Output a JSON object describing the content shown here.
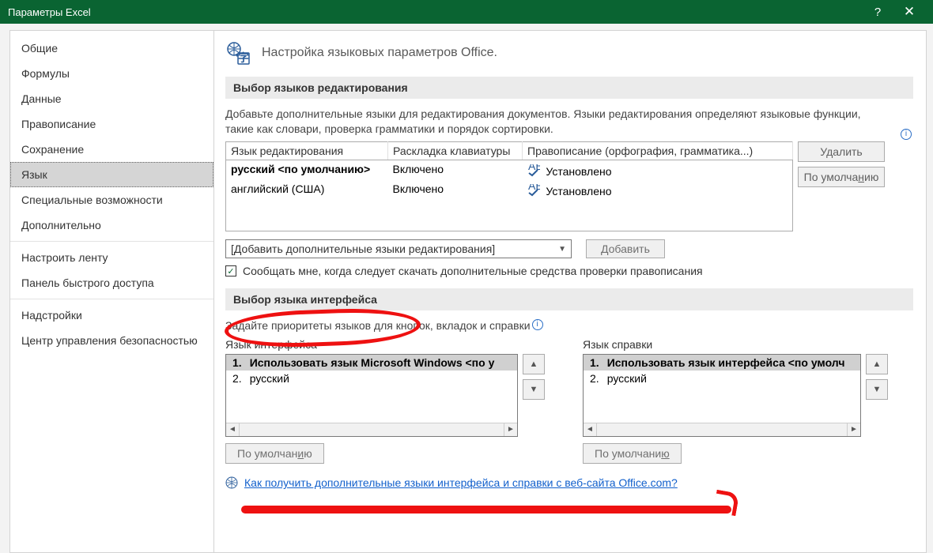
{
  "window": {
    "title": "Параметры Excel",
    "help": "?",
    "close": "✕"
  },
  "nav": {
    "items": [
      "Общие",
      "Формулы",
      "Данные",
      "Правописание",
      "Сохранение",
      "Язык",
      "Специальные возможности",
      "Дополнительно"
    ],
    "items2": [
      "Настроить ленту",
      "Панель быстрого доступа"
    ],
    "items3": [
      "Надстройки",
      "Центр управления безопасностью"
    ],
    "selected": "Язык"
  },
  "header": {
    "title": "Настройка языковых параметров Office."
  },
  "section1": {
    "title": "Выбор языков редактирования",
    "desc": "Добавьте дополнительные языки для редактирования документов. Языки редактирования определяют языковые функции, такие как словари, проверка грамматики и порядок сортировки.",
    "colLang": "Язык редактирования",
    "colLayout": "Раскладка клавиатуры",
    "colProof": "Правописание (орфография, грамматика...)",
    "rows": [
      {
        "lang": "русский <по умолчанию>",
        "layout": "Включено",
        "proof": "Установлено",
        "bold": true
      },
      {
        "lang": "английский (США)",
        "layout": "Включено",
        "proof": "Установлено",
        "bold": false
      }
    ],
    "btnRemove": "Удалить",
    "btnDefault": "По умолчанию",
    "addCombo": "[Добавить дополнительные языки редактирования]",
    "btnAdd": "Добавить",
    "notify": "Сообщать мне, когда следует скачать дополнительные средства проверки правописания"
  },
  "section2": {
    "title": "Выбор языка интерфейса",
    "desc": "Задайте приоритеты языков для кнопок, вкладок и справки",
    "left": {
      "label": "Язык интерфейса",
      "items": [
        {
          "n": "1.",
          "t": "Использовать язык Microsoft Windows <по у"
        },
        {
          "n": "2.",
          "t": "русский"
        }
      ],
      "btn": "По умолчанию"
    },
    "right": {
      "label": "Язык справки",
      "items": [
        {
          "n": "1.",
          "t": "Использовать язык интерфейса <по умолч"
        },
        {
          "n": "2.",
          "t": "русский"
        }
      ],
      "btn": "По умолчанию"
    },
    "link": "Как получить дополнительные языки интерфейса и справки с веб-сайта Office.com?"
  }
}
